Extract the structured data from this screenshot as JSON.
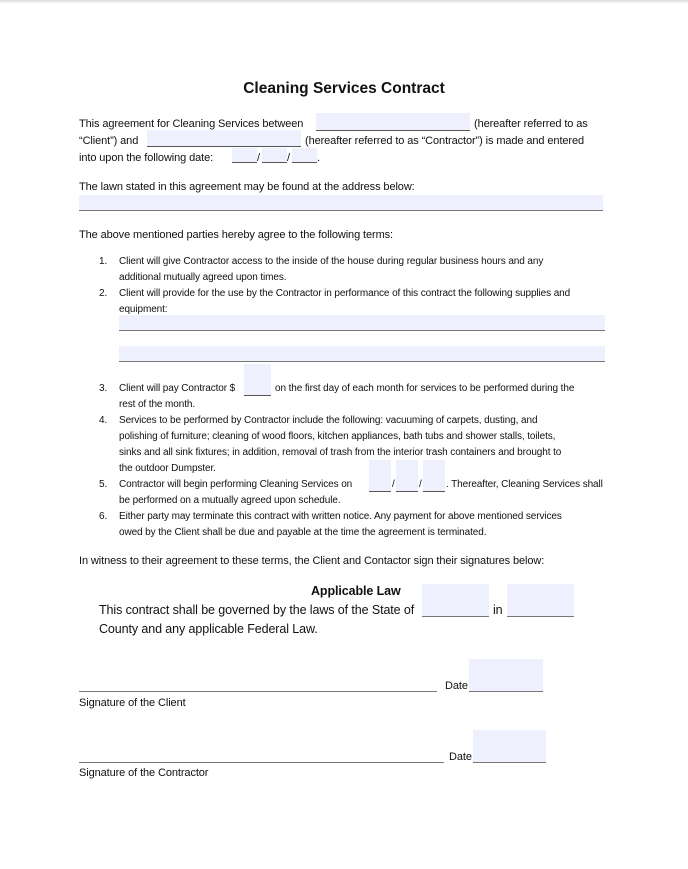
{
  "document": {
    "title": "Cleaning Services Contract",
    "intro": {
      "line1_a": "This agreement for Cleaning Services between",
      "line1_b": "(hereafter referred to as",
      "line2_a": "“Client”) and",
      "line2_b": "(hereafter referred to as “Contractor”) is made and entered",
      "line3_a": "into upon the following date:",
      "date_sep": "/",
      "period": "."
    },
    "address_intro": "The lawn stated in this agreement may be found at the address below:",
    "terms_intro": "The above mentioned parties hereby agree to the following terms:",
    "terms": [
      {
        "num": "1.",
        "lines": [
          "Client will give Contractor access to the inside of the house during regular business hours and any",
          "additional mutually agreed upon times."
        ]
      },
      {
        "num": "2.",
        "lines": [
          "Client will provide for the use by the Contractor in performance of this contract the following supplies and",
          "equipment:"
        ]
      },
      {
        "num": "3.",
        "line1_a": "Client will pay Contractor $",
        "line1_b": "on the first day of each month for services to be performed during the",
        "lines": [
          "rest of the month."
        ]
      },
      {
        "num": "4.",
        "lines": [
          "Services to be performed by Contractor include the following: vacuuming of carpets, dusting, and",
          "polishing of furniture; cleaning of wood floors, kitchen appliances, bath tubs and shower stalls, toilets,",
          "sinks and all sink fixtures; in addition, removal of trash from the interior trash containers and brought to",
          "the outdoor Dumpster."
        ]
      },
      {
        "num": "5.",
        "line1_a": "Contractor will begin performing Cleaning Services on",
        "line1_b": ". Thereafter, Cleaning Services shall",
        "lines": [
          "be performed on a mutually agreed upon schedule."
        ]
      },
      {
        "num": "6.",
        "lines": [
          "Either party may terminate this contract with written notice. Any payment for above mentioned services",
          "owed by the Client shall be due and payable at the time the agreement is terminated."
        ]
      }
    ],
    "witness": "In witness to their agreement to these terms, the Client and Contactor sign their signatures below:",
    "applicable_law": {
      "heading": "Applicable Law",
      "line1_a": "This contract shall be governed by the laws of the State of",
      "line1_in": "in",
      "line2": "County and any applicable Federal Law."
    },
    "signatures": {
      "date_label": "Date",
      "client_label": "Signature of the Client",
      "contractor_label": "Signature of the Contractor"
    },
    "fields": {
      "client_name": "",
      "contractor_name": "",
      "agreement_month": "",
      "agreement_day": "",
      "agreement_year": "",
      "address": "",
      "supplies_line1": "",
      "supplies_line2": "",
      "monthly_payment": "",
      "start_month": "",
      "start_day": "",
      "start_year": "",
      "state": "",
      "county": "",
      "client_sign_date": "",
      "contractor_sign_date": ""
    },
    "colors": {
      "field_fill": "#eef1fd",
      "text": "#111111"
    }
  }
}
